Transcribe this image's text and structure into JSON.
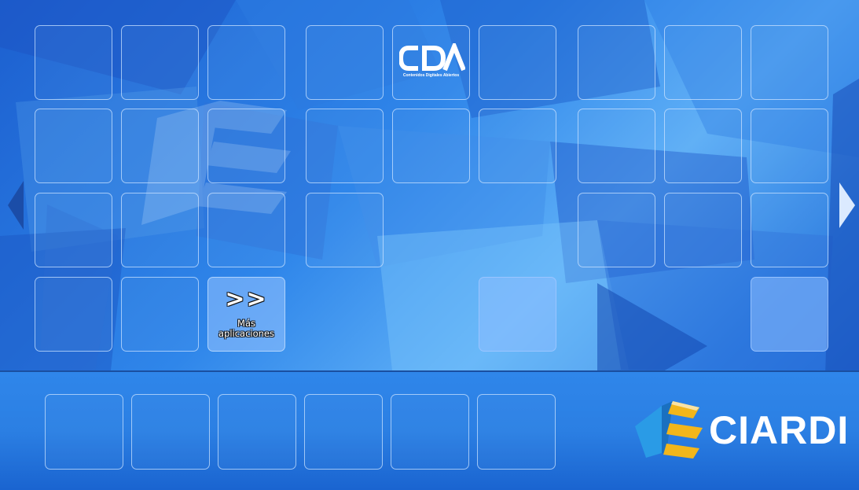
{
  "launcher": {
    "more_apps": {
      "arrows": ">>",
      "label": "Más aplicaciones"
    },
    "cda_logo": {
      "mark": "CDA",
      "tagline": "Contenidos Digitales Abiertos"
    }
  },
  "brand": {
    "name": "CIARDI",
    "colors": {
      "blue": "#2a9be6",
      "yellow": "#f2b61b",
      "white": "#ffffff"
    }
  },
  "icons": {
    "prev": "left-triangle-arrow",
    "next": "right-triangle-arrow"
  }
}
